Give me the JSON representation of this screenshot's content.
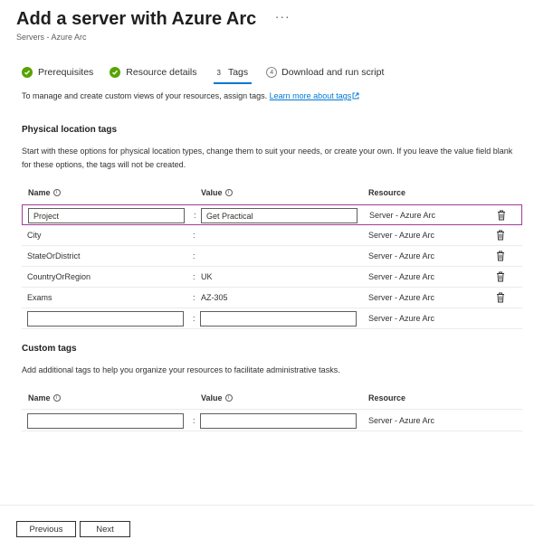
{
  "header": {
    "title": "Add a server with Azure Arc",
    "ellipsis": "···",
    "subtitle": "Servers - Azure Arc"
  },
  "tabs": [
    {
      "label": "Prerequisites",
      "state": "complete"
    },
    {
      "label": "Resource details",
      "state": "complete"
    },
    {
      "number": "3",
      "label": "Tags",
      "state": "active"
    },
    {
      "number": "4",
      "label": "Download and run script",
      "state": "pending"
    }
  ],
  "intro": {
    "text": "To manage and create custom views of your resources, assign tags.",
    "link": "Learn more about tags"
  },
  "physical": {
    "title": "Physical location tags",
    "description": "Start with these options for physical location types, change them to suit your needs, or create your own. If you leave the value field blank for these options, the tags will not be created.",
    "headers": {
      "name": "Name",
      "value": "Value",
      "resource": "Resource"
    },
    "rows": [
      {
        "name": "Project",
        "value": "Get Practical",
        "resource": "Server - Azure Arc",
        "editing": true
      },
      {
        "name": "City",
        "value": "",
        "resource": "Server - Azure Arc"
      },
      {
        "name": "StateOrDistrict",
        "value": "",
        "resource": "Server - Azure Arc"
      },
      {
        "name": "CountryOrRegion",
        "value": "UK",
        "resource": "Server - Azure Arc"
      },
      {
        "name": "Exams",
        "value": "AZ-305",
        "resource": "Server - Azure Arc"
      },
      {
        "name": "",
        "value": "",
        "resource": "Server - Azure Arc",
        "empty": true
      }
    ]
  },
  "custom": {
    "title": "Custom tags",
    "description": "Add additional tags to help you organize your resources to facilitate administrative tasks.",
    "headers": {
      "name": "Name",
      "value": "Value",
      "resource": "Resource"
    },
    "rows": [
      {
        "name": "",
        "value": "",
        "resource": "Server - Azure Arc",
        "empty": true
      }
    ]
  },
  "footer": {
    "previous": "Previous",
    "next": "Next"
  },
  "colors": {
    "accent": "#0078d4",
    "success": "#57a300",
    "selected_border": "#a23b9a"
  },
  "icons": {
    "tab_complete": "check-circle-icon",
    "info": "info-icon",
    "delete": "trash-icon",
    "external_link": "external-link-icon"
  }
}
